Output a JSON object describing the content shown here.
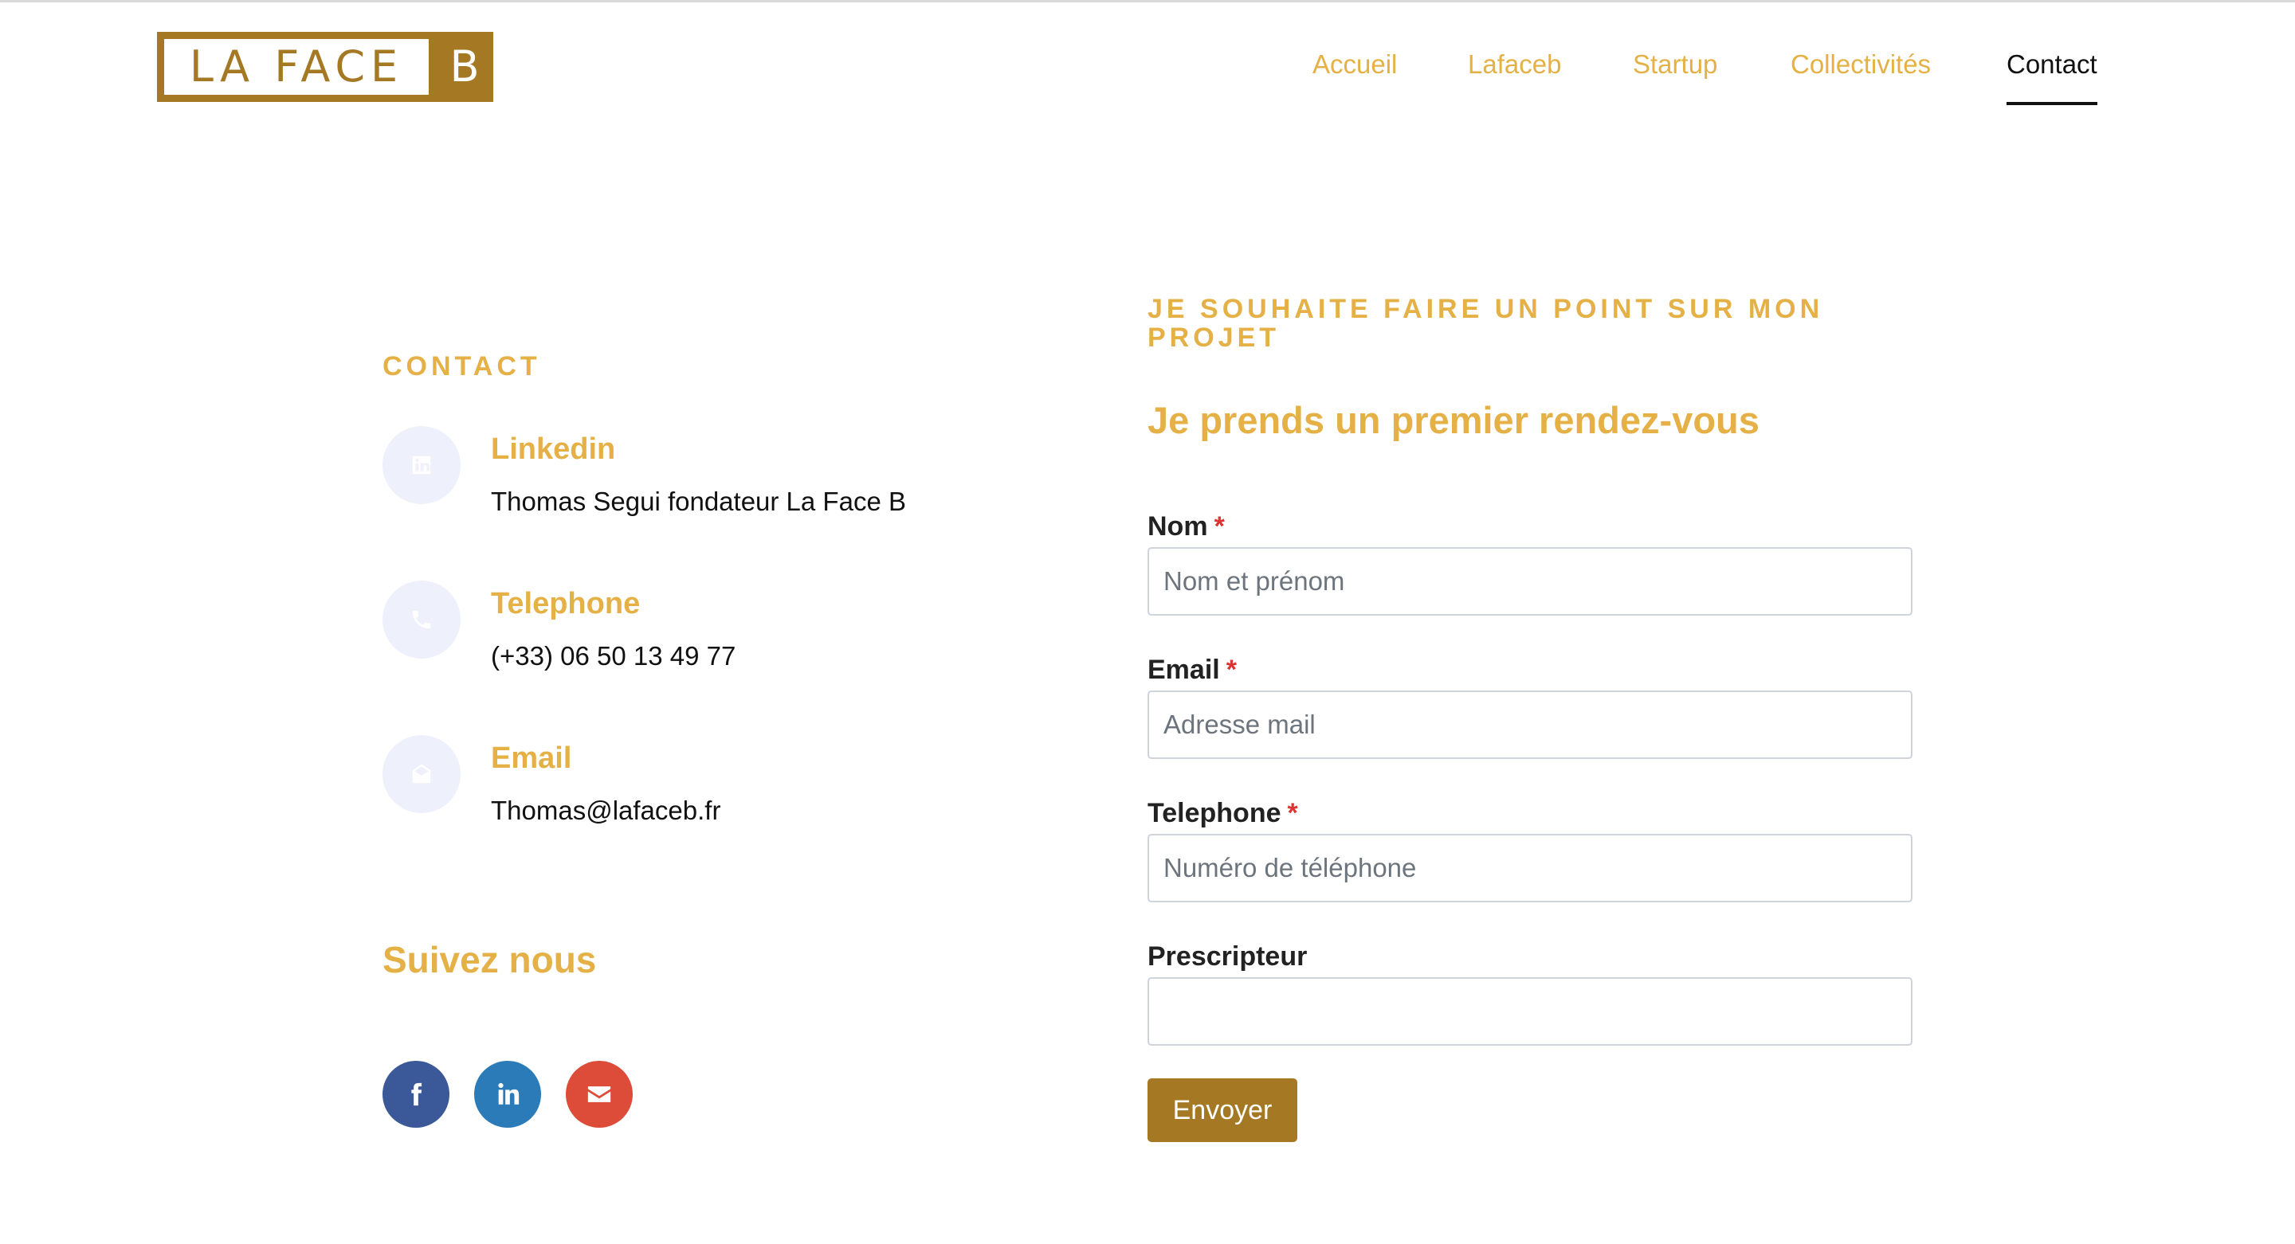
{
  "brand": {
    "logo_left": "LA FACE",
    "logo_right": "B"
  },
  "nav": {
    "items": [
      {
        "label": "Accueil"
      },
      {
        "label": "Lafaceb"
      },
      {
        "label": "Startup"
      },
      {
        "label": "Collectivités"
      },
      {
        "label": "Contact",
        "active": true
      }
    ]
  },
  "contact": {
    "eyebrow": "CONTACT",
    "items": [
      {
        "icon": "linkedin-icon",
        "title": "Linkedin",
        "value": "Thomas Segui fondateur La Face B"
      },
      {
        "icon": "phone-icon",
        "title": "Telephone",
        "value": "(+33) 06 50 13 49 77"
      },
      {
        "icon": "envelope-icon",
        "title": "Email",
        "value": "Thomas@lafaceb.fr"
      }
    ],
    "follow_title": "Suivez nous",
    "social": [
      {
        "icon": "facebook-icon",
        "color": "#3b5998"
      },
      {
        "icon": "linkedin-icon",
        "color": "#2b7bb9"
      },
      {
        "icon": "envelope-icon",
        "color": "#dd4b39"
      }
    ]
  },
  "form": {
    "eyebrow_line1": "JE SOUHAITE FAIRE UN POINT SUR MON",
    "eyebrow_line2": "PROJET",
    "heading": "Je prends un premier rendez-vous",
    "required_mark": "*",
    "fields": [
      {
        "label": "Nom",
        "placeholder": "Nom et prénom",
        "required": true,
        "value": ""
      },
      {
        "label": "Email",
        "placeholder": "Adresse mail",
        "required": true,
        "value": ""
      },
      {
        "label": "Telephone",
        "placeholder": "Numéro de téléphone",
        "required": true,
        "value": ""
      },
      {
        "label": "Prescripteur",
        "placeholder": "",
        "required": false,
        "value": ""
      }
    ],
    "submit_label": "Envoyer"
  },
  "colors": {
    "accent": "#e5b146",
    "brand": "#a57824",
    "text": "#111111",
    "icon_bg": "#eef0fb",
    "required": "#dd3333"
  }
}
